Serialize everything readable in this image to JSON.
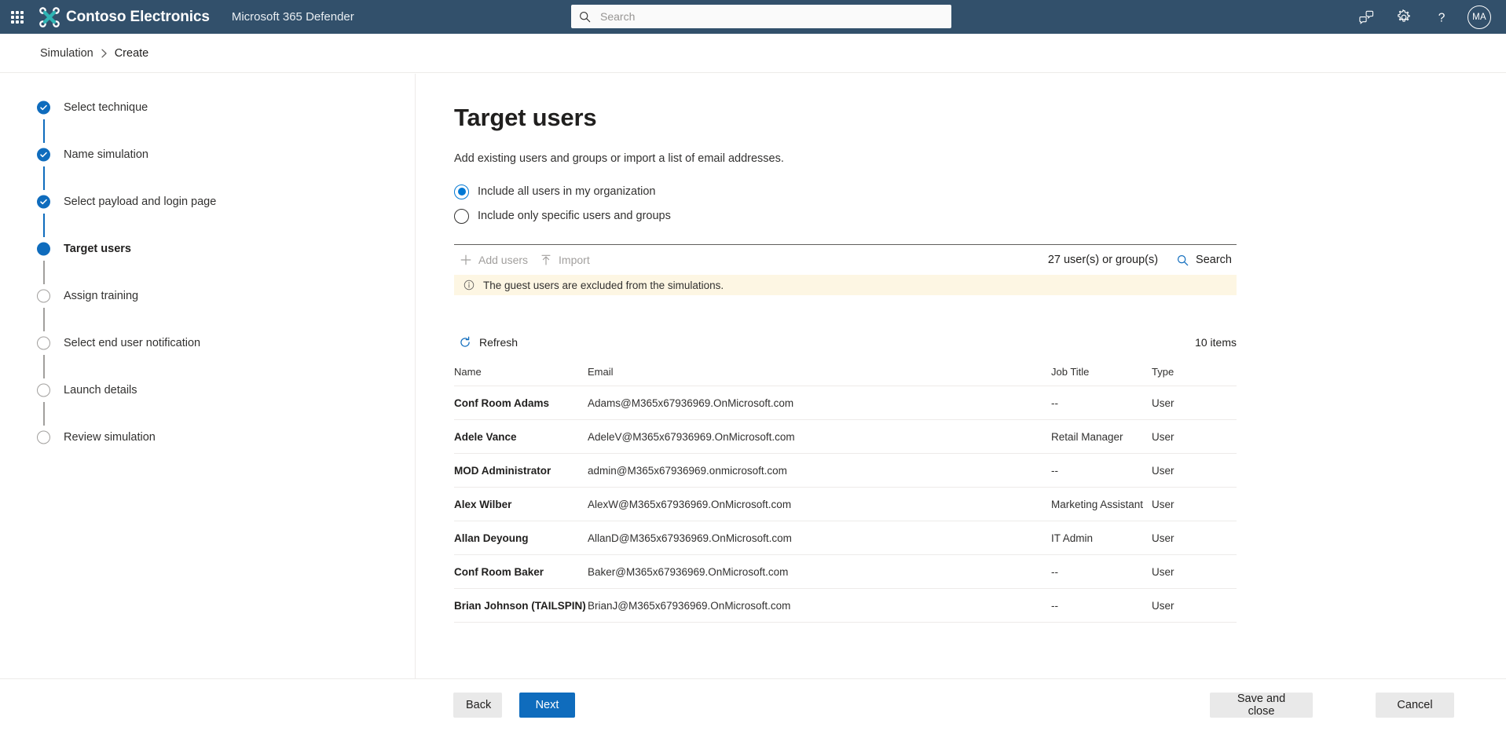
{
  "suitebar": {
    "waffle_label": "App launcher",
    "brand_name": "Contoso Electronics",
    "app_name": "Microsoft 365 Defender",
    "search_placeholder": "Search",
    "search_value": "",
    "actions": [
      {
        "name": "feedback-icon",
        "label": "Feedback"
      },
      {
        "name": "gear-icon",
        "label": "Settings"
      },
      {
        "name": "help-icon",
        "label": "Help"
      }
    ],
    "avatar_initials": "MA",
    "colors": {
      "bar_bg": "#32506b",
      "logo_teal": "#2fb4b4"
    }
  },
  "breadcrumb": {
    "root": "Simulation",
    "current": "Create"
  },
  "wizard": {
    "steps": [
      {
        "label": "Select technique",
        "state": "done"
      },
      {
        "label": "Name simulation",
        "state": "done"
      },
      {
        "label": "Select payload and login page",
        "state": "done"
      },
      {
        "label": "Target users",
        "state": "active"
      },
      {
        "label": "Assign training",
        "state": "todo"
      },
      {
        "label": "Select end user notification",
        "state": "todo"
      },
      {
        "label": "Launch details",
        "state": "todo"
      },
      {
        "label": "Review simulation",
        "state": "todo"
      }
    ]
  },
  "main": {
    "title": "Target users",
    "subtitle": "Add existing users and groups or import a list of email addresses.",
    "radios": [
      {
        "label": "Include all users in my organization",
        "selected": true
      },
      {
        "label": "Include only specific users and groups",
        "selected": false
      }
    ],
    "toolbar": {
      "add_users_label": "Add users",
      "add_users_enabled": false,
      "import_label": "Import",
      "import_enabled": false,
      "count_label": "27 user(s) or group(s)",
      "search_label": "Search"
    },
    "message_bar": {
      "icon": "info-icon",
      "text": "The guest users are excluded from the simulations.",
      "bg": "#fdf6e3"
    },
    "list": {
      "refresh_label": "Refresh",
      "items_label": "10 items",
      "columns": [
        "Name",
        "Email",
        "Job Title",
        "Type"
      ],
      "rows": [
        {
          "name": "Conf Room Adams",
          "email": "Adams@M365x67936969.OnMicrosoft.com",
          "job": "--",
          "type": "User"
        },
        {
          "name": "Adele Vance",
          "email": "AdeleV@M365x67936969.OnMicrosoft.com",
          "job": "Retail Manager",
          "type": "User"
        },
        {
          "name": "MOD Administrator",
          "email": "admin@M365x67936969.onmicrosoft.com",
          "job": "--",
          "type": "User"
        },
        {
          "name": "Alex Wilber",
          "email": "AlexW@M365x67936969.OnMicrosoft.com",
          "job": "Marketing Assistant",
          "type": "User"
        },
        {
          "name": "Allan Deyoung",
          "email": "AllanD@M365x67936969.OnMicrosoft.com",
          "job": "IT Admin",
          "type": "User"
        },
        {
          "name": "Conf Room Baker",
          "email": "Baker@M365x67936969.OnMicrosoft.com",
          "job": "--",
          "type": "User"
        },
        {
          "name": "Brian Johnson (TAILSPIN)",
          "email": "BrianJ@M365x67936969.OnMicrosoft.com",
          "job": "--",
          "type": "User"
        }
      ]
    }
  },
  "footer": {
    "back_label": "Back",
    "next_label": "Next",
    "save_label": "Save and close",
    "cancel_label": "Cancel",
    "primary_color": "#0f6cbd"
  }
}
